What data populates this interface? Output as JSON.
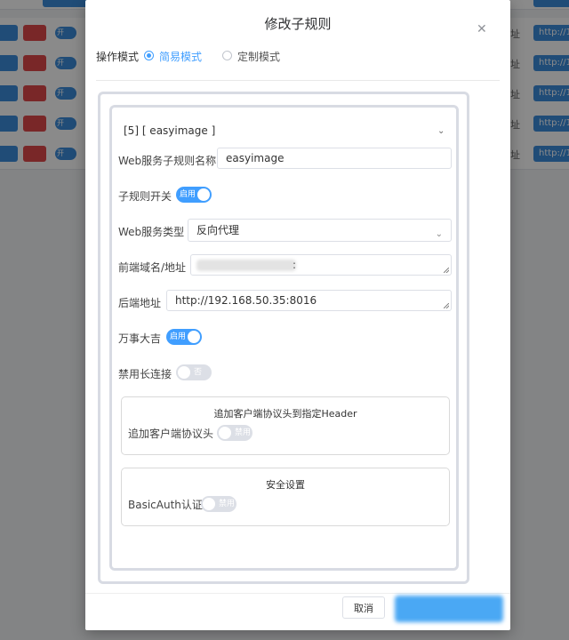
{
  "background": {
    "rows": [
      {
        "toggle_label": "开",
        "side_text": "址",
        "link_text": "http://1"
      },
      {
        "toggle_label": "开",
        "side_text": "址",
        "link_text": "http://1"
      },
      {
        "toggle_label": "开",
        "side_text": "址",
        "link_text": "http://1"
      },
      {
        "toggle_label": "开",
        "side_text": "址",
        "link_text": "http://1"
      },
      {
        "toggle_label": "开",
        "side_text": "址",
        "link_text": "http://1"
      }
    ]
  },
  "dialog": {
    "title": "修改子规则",
    "close_icon": "close-icon",
    "mode": {
      "label": "操作模式",
      "options": [
        {
          "label": "简易模式",
          "selected": true
        },
        {
          "label": "定制模式",
          "selected": false
        }
      ]
    },
    "rule": {
      "header": "[5] [ easyimage ]",
      "chevron_icon": "chevron-down-icon",
      "name_label": "Web服务子规则名称",
      "name_value": "easyimage",
      "switch_label": "子规则开关",
      "switch_state": "启用",
      "type_label": "Web服务类型",
      "type_value": "反向代理",
      "frontend_label": "前端域名/地址",
      "frontend_suffix": ":",
      "backend_label": "后端地址",
      "backend_value": "http://192.168.50.35:8016",
      "luck_label": "万事大吉",
      "luck_state": "启用",
      "keepalive_label": "禁用长连接",
      "keepalive_state": "否",
      "header_group": {
        "title": "追加客户端协议头到指定Header",
        "label": "追加客户端协议头",
        "state": "禁用"
      },
      "security_group": {
        "title": "安全设置",
        "label": "BasicAuth认证",
        "state": "禁用"
      }
    },
    "footer": {
      "cancel_label": "取消"
    }
  },
  "colors": {
    "primary": "#409eff",
    "danger": "#e0484a",
    "border": "#dcdfe6"
  }
}
